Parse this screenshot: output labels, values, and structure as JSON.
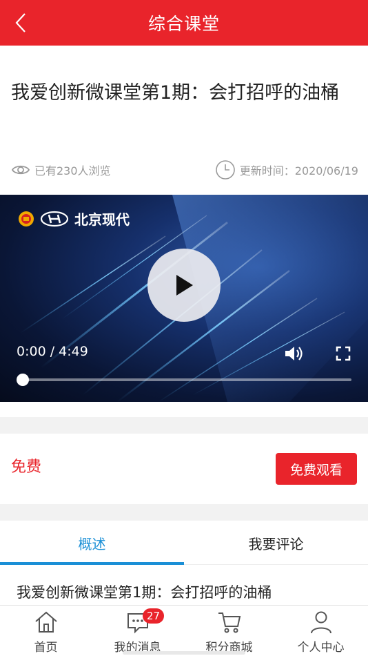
{
  "header": {
    "title": "综合课堂",
    "back_icon": "chevron-left-icon"
  },
  "article": {
    "title": "我爱创新微课堂第1期：会打招呼的油桶",
    "views": "已有230人浏览",
    "updated": "更新时间：2020/06/19"
  },
  "video": {
    "brand": "北京现代",
    "time": "0:00 / 4:49",
    "progress": 0,
    "play_icon": "play-icon",
    "volume_icon": "volume-icon",
    "fullscreen_icon": "fullscreen-icon"
  },
  "purchase": {
    "price": "免费",
    "watch_label": "免费观看"
  },
  "tabs": [
    {
      "label": "概述",
      "active": true
    },
    {
      "label": "我要评论",
      "active": false
    }
  ],
  "overview": {
    "text": "我爱创新微课堂第1期：会打招呼的油桶"
  },
  "bottom_nav": [
    {
      "label": "首页",
      "icon": "home-icon"
    },
    {
      "label": "我的消息",
      "icon": "message-icon",
      "badge": "27"
    },
    {
      "label": "积分商城",
      "icon": "cart-icon"
    },
    {
      "label": "个人中心",
      "icon": "user-icon"
    }
  ],
  "colors": {
    "brand_red": "#e9242b",
    "tab_blue": "#1a8fd6",
    "meta_gray": "#999999"
  }
}
